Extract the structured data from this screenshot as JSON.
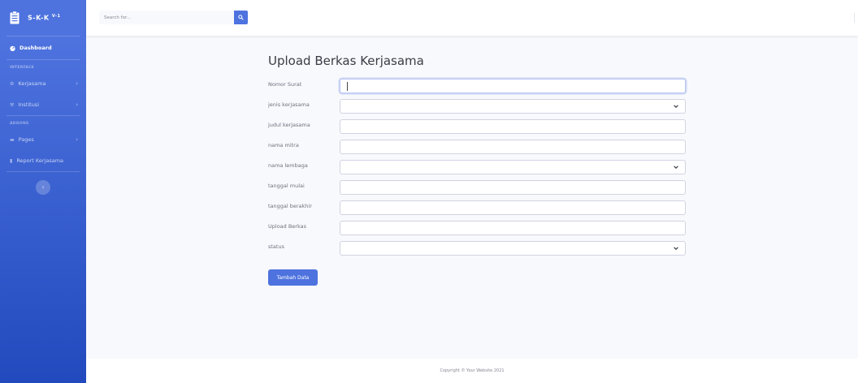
{
  "brand": {
    "name": "S-K-K",
    "version": "V-1"
  },
  "sidebar": {
    "dashboard": "Dashboard",
    "heading_interface": "INTERFACE",
    "heading_addons": "ADDONS",
    "items": [
      {
        "label": "Kerjasama",
        "icon": "gear-icon"
      },
      {
        "label": "Institusi",
        "icon": "wrench-icon"
      },
      {
        "label": "Pages",
        "icon": "folder-icon"
      },
      {
        "label": "Report Kerjasama",
        "icon": "chart-icon"
      }
    ],
    "toggle": "‹"
  },
  "search": {
    "placeholder": "Search for..."
  },
  "page": {
    "title": "Upload Berkas Kerjasama"
  },
  "form": {
    "fields": [
      {
        "label": "Nomor Surat",
        "value": "",
        "type": "text"
      },
      {
        "label": "jenis kerjasama",
        "value": "",
        "type": "select"
      },
      {
        "label": "judul kerjasama",
        "value": "",
        "type": "text"
      },
      {
        "label": "nama mitra",
        "value": "",
        "type": "text"
      },
      {
        "label": "nama lembaga",
        "value": "",
        "type": "select"
      },
      {
        "label": "tanggal mulai",
        "value": "",
        "type": "text"
      },
      {
        "label": "tanggal berakhir",
        "value": "",
        "type": "text"
      },
      {
        "label": "Upload Berkas",
        "value": "",
        "type": "text"
      },
      {
        "label": "status",
        "value": "",
        "type": "select"
      }
    ],
    "submit_label": "Tambah Data"
  },
  "footer": {
    "text": "Copyright © Your Website 2021"
  },
  "colors": {
    "primary": "#4e73df",
    "sidebar_dark": "#224abe",
    "background": "#f8f9fc"
  }
}
